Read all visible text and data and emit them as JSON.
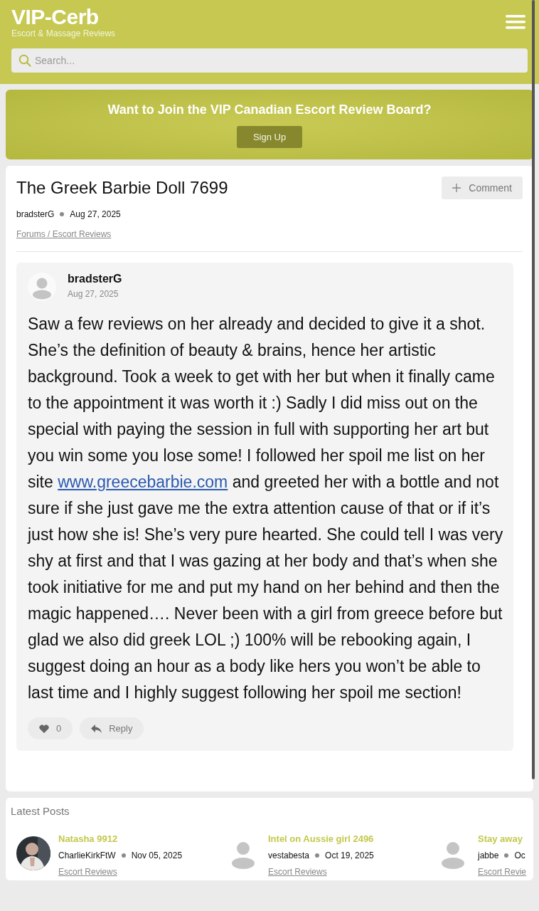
{
  "header": {
    "logo": "VIP-Cerb",
    "tagline": "Escort & Massage Reviews",
    "search": {
      "placeholder": "Search..."
    }
  },
  "banner": {
    "title": "Want to Join the VIP Canadian Escort Review Board?",
    "button": "Sign Up"
  },
  "thread": {
    "title": "The Greek Barbie Doll 7699",
    "comment_button": "Comment",
    "author": "bradsterG",
    "date": "Aug 27, 2025",
    "breadcrumb": "Forums / Escort Reviews"
  },
  "post": {
    "author": "bradsterG",
    "date": "Aug 27, 2025",
    "text_before": "Saw a few reviews on her already and decided to give it a shot. She’s the definition of beauty & brains, hence her artistic background. Took a week to get with her but when it finally came to the appointment it was worth it :) Sadly I did miss out on the special with paying the session in full with supporting her art but you win some you lose some! I followed her spoil me list on her site ",
    "link": "www.greecebarbie.com",
    "text_after": " and greeted her with a bottle and not sure if she just gave me the extra attention cause of that or if it’s just how she is! She’s very pure hearted. She could tell I was very shy at first and that I was gazing at her body and that’s when she took initiative for me and put my hand on her behind and then the magic happened…. Never been with a girl from greece before but glad we also did greek LOL ;) 100% will be rebooking again, I suggest doing an hour as a body like hers you won’t be able to last time and I highly suggest following her spoil me section!",
    "likes": "0",
    "reply_button": "Reply"
  },
  "latest_posts": {
    "title": "Latest Posts",
    "items": [
      {
        "title": "Natasha 9912",
        "author": "CharlieKirkFtW",
        "date": "Nov 05, 2025",
        "category": "Escort Reviews"
      },
      {
        "kind": "default",
        "title": "Intel on Aussie girl 2496",
        "author": "vestabesta",
        "date": "Oct 19, 2025",
        "category": "Escort Reviews"
      },
      {
        "kind": "default",
        "title": "Stay away",
        "author": "jabbe",
        "date": "Oc",
        "category": "Escort Revie"
      }
    ]
  }
}
